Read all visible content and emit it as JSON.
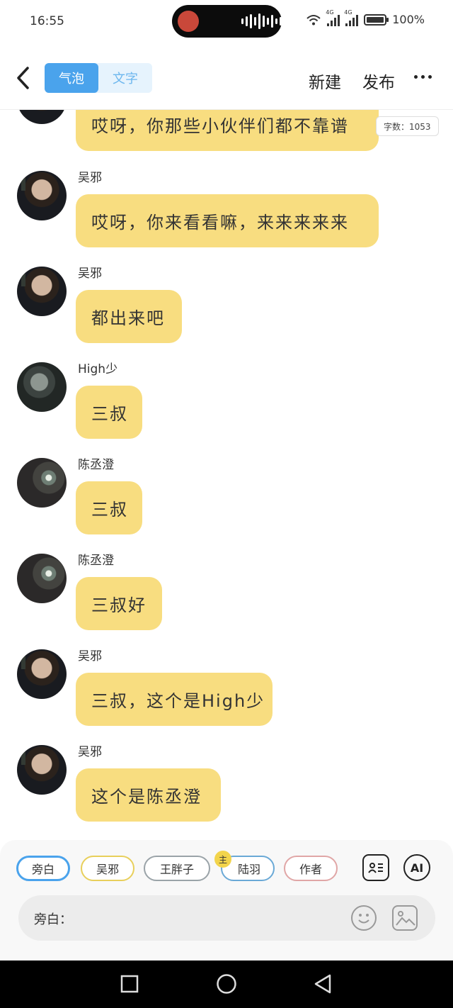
{
  "status_bar": {
    "time": "16:55",
    "network_1": "4G",
    "network_2": "4G",
    "battery": "100%"
  },
  "header": {
    "tabs": [
      {
        "label": "气泡",
        "active": true
      },
      {
        "label": "文字",
        "active": false
      }
    ],
    "new_label": "新建",
    "publish_label": "发布"
  },
  "messages": [
    {
      "name": "",
      "text": "哎呀，你那些小伙伴们都不靠谱",
      "avatar": "wu-avatar",
      "word_count": "字数：1053"
    },
    {
      "name": "吴邪",
      "text": "哎呀，你来看看嘛，来来来来来",
      "avatar": "wu-avatar"
    },
    {
      "name": "吴邪",
      "text": "都出来吧",
      "avatar": "wu-avatar"
    },
    {
      "name": "High少",
      "text": "三叔",
      "avatar": "high-avatar"
    },
    {
      "name": "陈丞澄",
      "text": "三叔",
      "avatar": "chen-avatar"
    },
    {
      "name": "陈丞澄",
      "text": "三叔好",
      "avatar": "chen-avatar"
    },
    {
      "name": "吴邪",
      "text": "三叔，这个是High少",
      "avatar": "wu-avatar"
    },
    {
      "name": "吴邪",
      "text": "这个是陈丞澄",
      "avatar": "wu-avatar"
    }
  ],
  "characters": [
    {
      "label": "旁白",
      "selected": true,
      "border_color": "#4aa3ec"
    },
    {
      "label": "吴邪",
      "selected": false,
      "border_color": "#e8cf5b"
    },
    {
      "label": "王胖子",
      "selected": false,
      "border_color": "#9aa3a8"
    },
    {
      "label": "陆羽",
      "selected": false,
      "border_color": "#6aa9d6",
      "badge": "主"
    },
    {
      "label": "作者",
      "selected": false,
      "border_color": "#e0a6a6"
    }
  ],
  "toolbar": {
    "ai_label": "AI"
  },
  "input": {
    "speaker_label": "旁白："
  },
  "colors": {
    "bubble": "#f8dd80",
    "accent": "#4aa3ec"
  }
}
